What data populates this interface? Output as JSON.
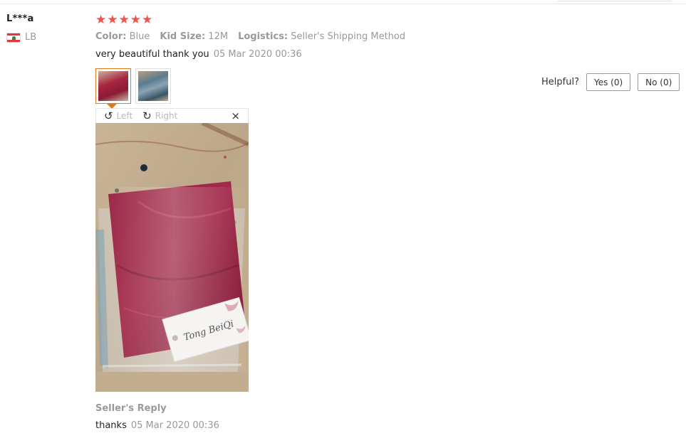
{
  "reviewer": {
    "name": "L***a",
    "country_code": "LB"
  },
  "rating": {
    "stars": 5,
    "max": 5,
    "star_color": "#f5504a"
  },
  "attributes": [
    {
      "key": "Color:",
      "value": "Blue"
    },
    {
      "key": "Kid Size:",
      "value": "12M"
    },
    {
      "key": "Logistics:",
      "value": "Seller's Shipping Method"
    }
  ],
  "feedback": {
    "text": "very beautiful thank you",
    "date": "05 Mar 2020 00:36"
  },
  "photos": {
    "selected_index": 0,
    "accent_color": "#e07a1f",
    "viewer": {
      "rotate_left_label": "Left",
      "rotate_right_label": "Right",
      "close_glyph": "×",
      "product_tag_text": "Tong BeiQi"
    }
  },
  "helpful": {
    "label": "Helpful?",
    "yes_label": "Yes (0)",
    "no_label": "No (0)"
  },
  "seller_reply": {
    "title": "Seller's Reply",
    "text": "thanks",
    "date": "05 Mar 2020 00:36"
  }
}
